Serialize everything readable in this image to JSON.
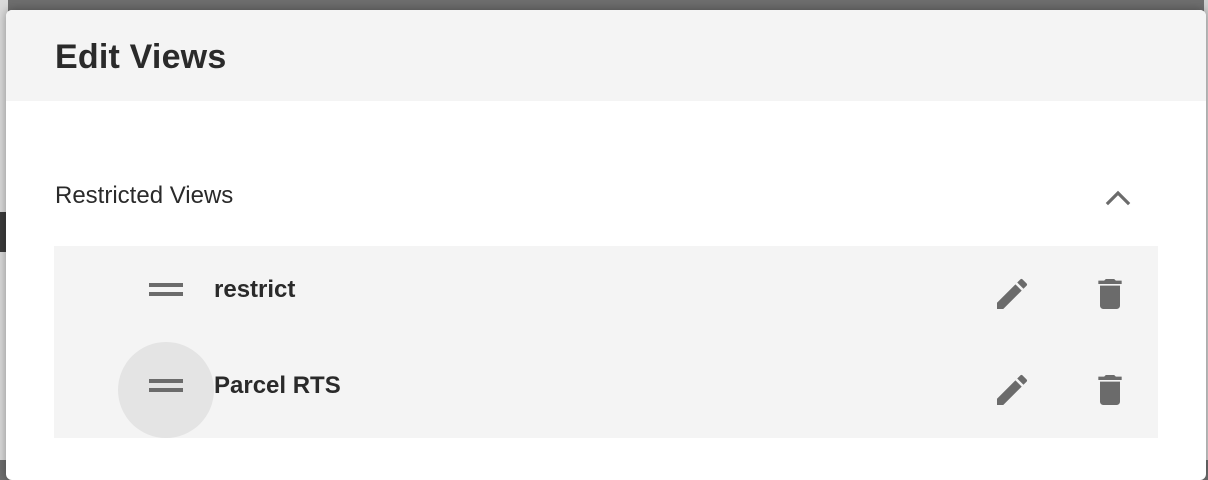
{
  "modal": {
    "title": "Edit Views"
  },
  "section": {
    "title": "Restricted Views",
    "expanded": true
  },
  "views": [
    {
      "label": "restrict"
    },
    {
      "label": "Parcel RTS"
    }
  ],
  "icons": {
    "collapse": "chevron-up-icon",
    "drag": "drag-handle-icon",
    "edit": "pencil-icon",
    "delete": "trash-icon"
  },
  "colors": {
    "icon": "#6b6b6b",
    "text": "#2a2a2a",
    "header_bg": "#f4f4f4"
  }
}
